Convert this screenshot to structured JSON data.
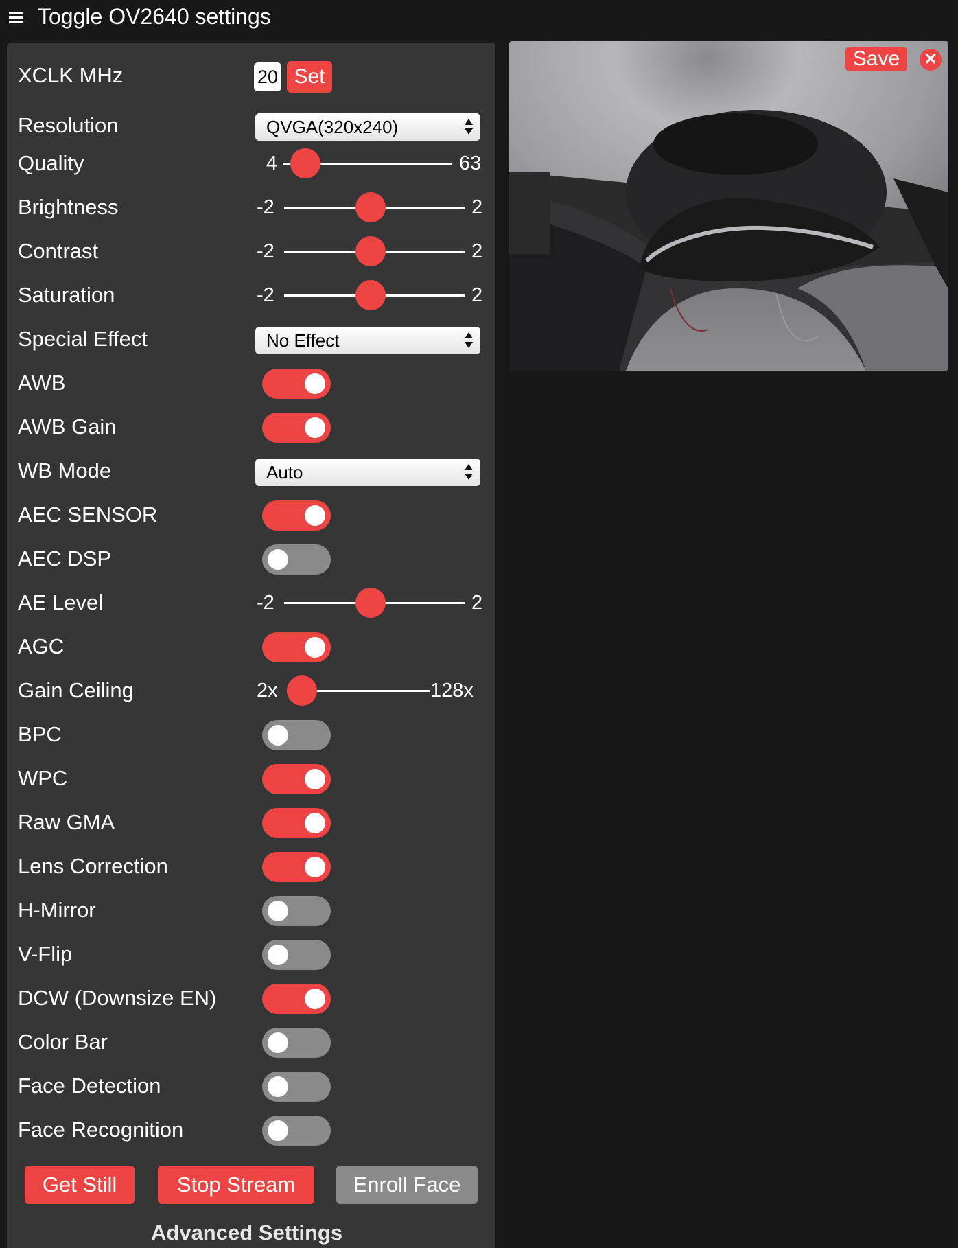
{
  "header": {
    "title": "Toggle OV2640 settings",
    "menu_icon": "hamburger-menu-icon"
  },
  "colors": {
    "accent": "#ef4444",
    "panel": "#363636",
    "background": "#181818",
    "toggle_off": "#8a8a8a"
  },
  "settings": {
    "xclk": {
      "label": "XCLK MHz",
      "value": "20",
      "button": "Set"
    },
    "resolution": {
      "label": "Resolution",
      "value": "QVGA(320x240)"
    },
    "quality": {
      "label": "Quality",
      "min": "4",
      "max": "63",
      "value": 10
    },
    "brightness": {
      "label": "Brightness",
      "min": "-2",
      "max": "2",
      "value": 0
    },
    "contrast": {
      "label": "Contrast",
      "min": "-2",
      "max": "2",
      "value": 0
    },
    "saturation": {
      "label": "Saturation",
      "min": "-2",
      "max": "2",
      "value": 0
    },
    "special_effect": {
      "label": "Special Effect",
      "value": "No Effect"
    },
    "awb": {
      "label": "AWB",
      "on": true
    },
    "awb_gain": {
      "label": "AWB Gain",
      "on": true
    },
    "wb_mode": {
      "label": "WB Mode",
      "value": "Auto"
    },
    "aec_sensor": {
      "label": "AEC SENSOR",
      "on": true
    },
    "aec_dsp": {
      "label": "AEC DSP",
      "on": false
    },
    "ae_level": {
      "label": "AE Level",
      "min": "-2",
      "max": "2",
      "value": 0
    },
    "agc": {
      "label": "AGC",
      "on": true
    },
    "gain_ceiling": {
      "label": "Gain Ceiling",
      "min": "2x",
      "max": "128x",
      "value": 0
    },
    "bpc": {
      "label": "BPC",
      "on": false
    },
    "wpc": {
      "label": "WPC",
      "on": true
    },
    "raw_gma": {
      "label": "Raw GMA",
      "on": true
    },
    "lens_correction": {
      "label": "Lens Correction",
      "on": true
    },
    "h_mirror": {
      "label": "H-Mirror",
      "on": false
    },
    "v_flip": {
      "label": "V-Flip",
      "on": false
    },
    "dcw": {
      "label": "DCW (Downsize EN)",
      "on": true
    },
    "color_bar": {
      "label": "Color Bar",
      "on": false
    },
    "face_detection": {
      "label": "Face Detection",
      "on": false
    },
    "face_recognition": {
      "label": "Face Recognition",
      "on": false
    }
  },
  "actions": {
    "get_still": "Get Still",
    "stop_stream": "Stop Stream",
    "enroll_face": "Enroll Face"
  },
  "advanced_settings": "Advanced Settings",
  "preview": {
    "save": "Save",
    "close_icon": "close-icon"
  }
}
